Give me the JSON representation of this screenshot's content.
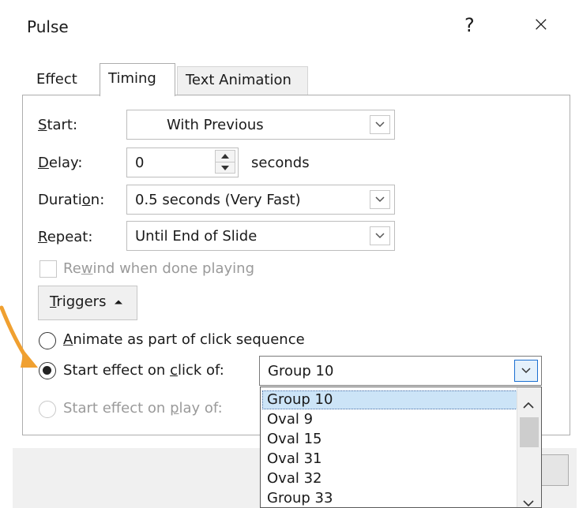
{
  "window": {
    "title": "Pulse",
    "help_label": "?",
    "close_label": "×"
  },
  "tabs": [
    {
      "label": "Effect"
    },
    {
      "label": "Timing"
    },
    {
      "label": "Text Animation"
    }
  ],
  "timing": {
    "start_label_pre": "",
    "start_label_u": "S",
    "start_label_post": "tart:",
    "start_value": "With Previous",
    "delay_label_u": "D",
    "delay_label_post": "elay:",
    "delay_value": "0",
    "delay_unit": "seconds",
    "duration_label_pre": "Durati",
    "duration_label_u": "o",
    "duration_label_post": "n:",
    "duration_value": "0.5 seconds (Very Fast)",
    "repeat_label_u": "R",
    "repeat_label_post": "epeat:",
    "repeat_value": "Until End of Slide",
    "rewind_pre": "Re",
    "rewind_u": "w",
    "rewind_post": "ind when done playing",
    "triggers_u": "T",
    "triggers_post": "riggers",
    "triggers_icon": "⏶"
  },
  "triggers": {
    "option1_u": "A",
    "option1_post": "nimate as part of click sequence",
    "option2_pre": "Start effect on ",
    "option2_u": "c",
    "option2_post": "lick of:",
    "option3_pre": "Start effect on ",
    "option3_u": "p",
    "option3_post": "lay of:",
    "selected_object": "Group 10",
    "object_options": [
      "Group 10",
      "Oval 9",
      "Oval 15",
      "Oval 31",
      "Oval 32",
      "Group 33"
    ]
  },
  "colors": {
    "accent": "#f0a030",
    "selection": "#cce4f7"
  }
}
